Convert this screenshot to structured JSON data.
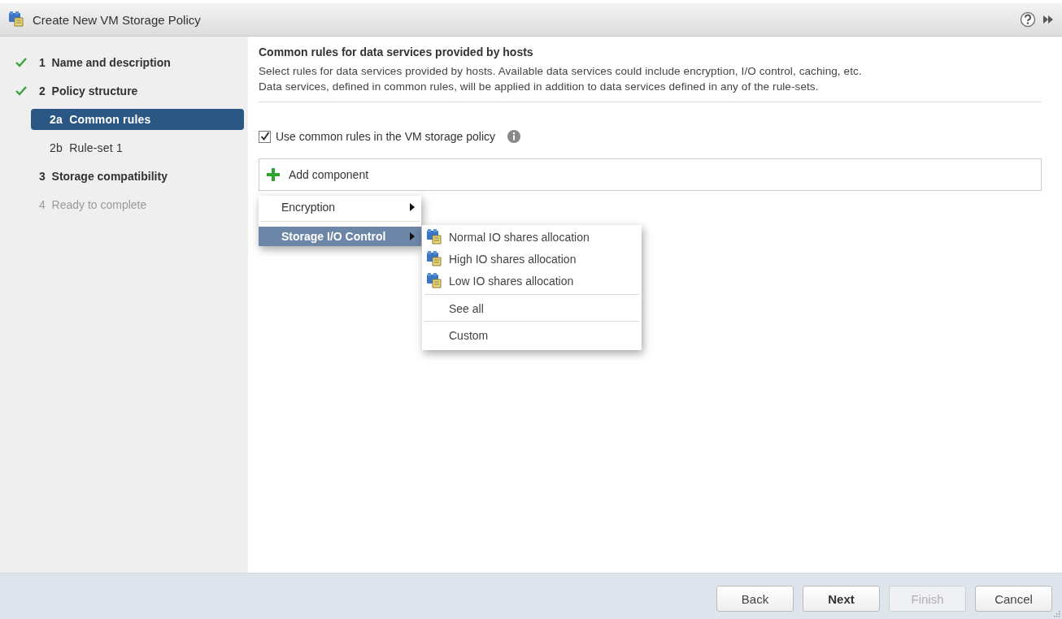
{
  "window": {
    "title": "Create New VM Storage Policy"
  },
  "steps": [
    {
      "number": "1",
      "label": "Name and description",
      "completed": true,
      "selected": false,
      "disabled": false
    },
    {
      "number": "2",
      "label": "Policy structure",
      "completed": true,
      "selected": false,
      "disabled": false,
      "children": [
        {
          "number": "2a",
          "label": "Common rules",
          "completed": false,
          "selected": true,
          "disabled": false
        },
        {
          "number": "2b",
          "label": "Rule-set 1",
          "completed": false,
          "selected": false,
          "disabled": false
        }
      ]
    },
    {
      "number": "3",
      "label": "Storage compatibility",
      "completed": false,
      "selected": false,
      "disabled": false
    },
    {
      "number": "4",
      "label": "Ready to complete",
      "completed": false,
      "selected": false,
      "disabled": true
    }
  ],
  "content": {
    "heading": "Common rules for data services provided by hosts",
    "description_lines": [
      "Select rules for data services provided by hosts. Available data services could include encryption, I/O control, caching, etc.",
      "Data services, defined in common rules, will be applied in addition to data services defined in any of the rule-sets."
    ],
    "use_common_rules": {
      "label": "Use common rules in the VM storage policy",
      "checked": true
    },
    "add_component": {
      "label": "Add component"
    }
  },
  "menu": {
    "items": [
      {
        "label": "Encryption",
        "selected": false
      },
      {
        "label": "Storage I/O Control",
        "selected": true
      }
    ],
    "submenu": {
      "items": [
        {
          "label": "Normal IO shares allocation",
          "kind": "profile"
        },
        {
          "label": "High IO shares allocation",
          "kind": "profile"
        },
        {
          "label": "Low IO shares allocation",
          "kind": "profile"
        },
        {
          "label": "See all",
          "kind": "plain"
        },
        {
          "label": "Custom",
          "kind": "plain"
        }
      ]
    }
  },
  "buttons": [
    {
      "label": "Back",
      "primary": false,
      "disabled": false
    },
    {
      "label": "Next",
      "primary": true,
      "disabled": false
    },
    {
      "label": "Finish",
      "primary": false,
      "disabled": true
    },
    {
      "label": "Cancel",
      "primary": false,
      "disabled": false
    }
  ]
}
